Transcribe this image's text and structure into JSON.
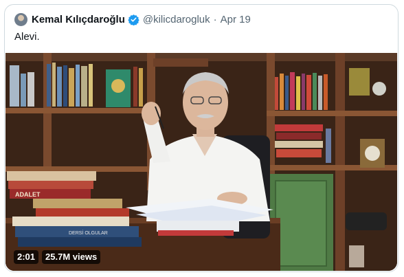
{
  "tweet": {
    "author_name": "Kemal Kılıçdaroğlu",
    "handle": "@kilicdarogluk",
    "separator": "·",
    "date": "Apr 19",
    "text": "Alevi.",
    "verified_color": "#1d9bf0"
  },
  "video": {
    "duration": "2:01",
    "views": "25.7M views",
    "book_spine_top": "ADALET",
    "book_spine_blue": "DERSİ OLGULAR"
  }
}
